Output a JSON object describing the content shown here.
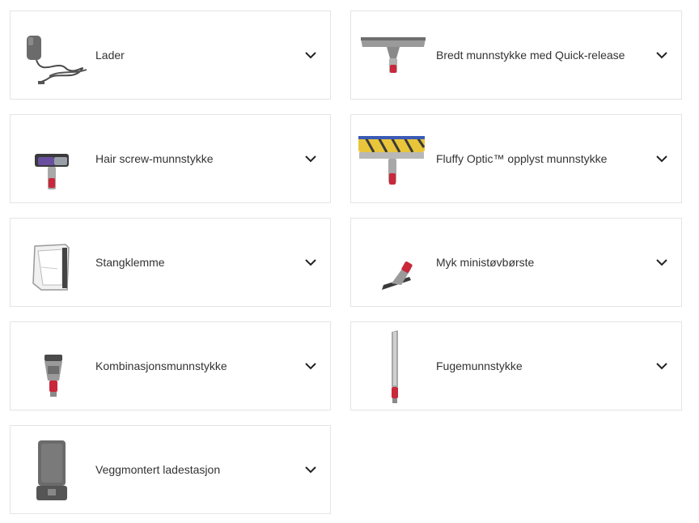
{
  "accessories": [
    {
      "label": "Lader",
      "icon": "charger-icon"
    },
    {
      "label": "Bredt munnstykke med Quick-release",
      "icon": "wide-nozzle-icon"
    },
    {
      "label": "Hair screw-munnstykke",
      "icon": "hair-screw-tool-icon"
    },
    {
      "label": "Fluffy Optic™ opplyst munnstykke",
      "icon": "fluffy-optic-head-icon"
    },
    {
      "label": "Stangklemme",
      "icon": "wand-clip-icon"
    },
    {
      "label": "Myk ministøvbørste",
      "icon": "mini-soft-dusting-brush-icon"
    },
    {
      "label": "Kombinasjonsmunnstykke",
      "icon": "combination-tool-icon"
    },
    {
      "label": "Fugemunnstykke",
      "icon": "crevice-tool-icon"
    },
    {
      "label": "Veggmontert ladestasjon",
      "icon": "wall-dock-icon"
    }
  ],
  "colors": {
    "card_border": "#e4e4e4",
    "text": "#333333",
    "accent_red": "#c8283a"
  }
}
